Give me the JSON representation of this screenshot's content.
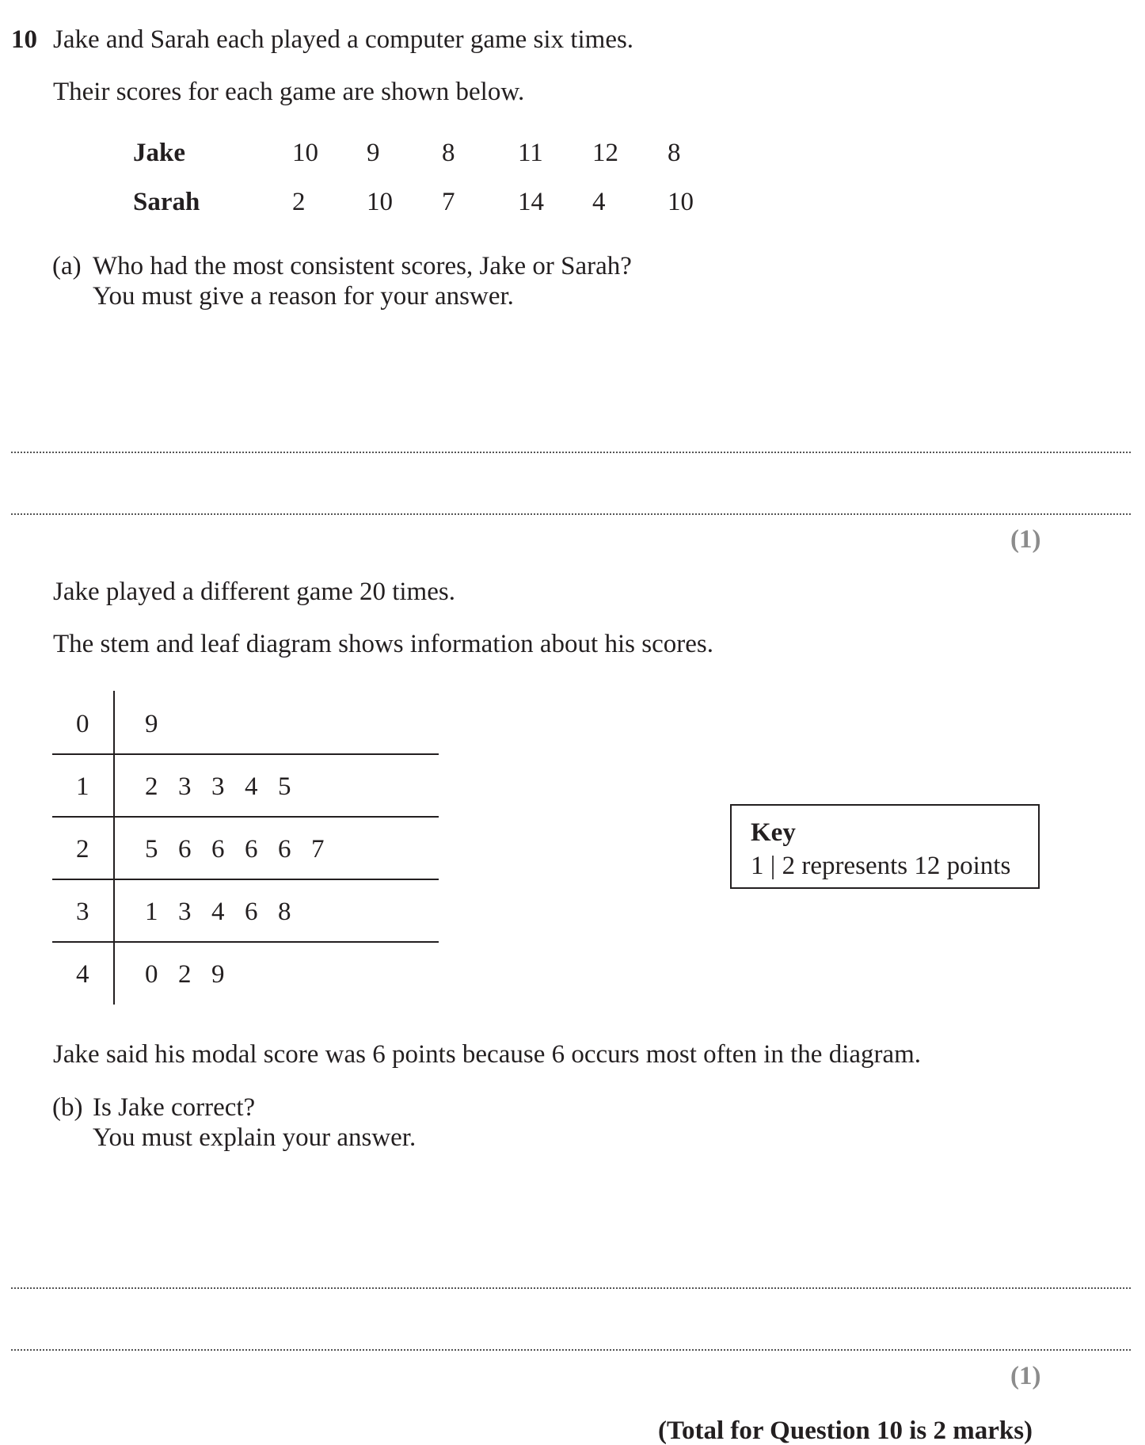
{
  "question": {
    "number": "10",
    "intro": "Jake and Sarah each played a computer game six times.",
    "scores_intro": "Their scores for each game are shown below."
  },
  "scores_table": {
    "rows": [
      {
        "name": "Jake",
        "values": [
          "10",
          "9",
          "8",
          "11",
          "12",
          "8"
        ]
      },
      {
        "name": "Sarah",
        "values": [
          "2",
          "10",
          "7",
          "14",
          "4",
          "10"
        ]
      }
    ]
  },
  "part_a": {
    "label": "(a)",
    "line1": "Who had the most consistent scores, Jake or Sarah?",
    "line2": "You must give a reason for your answer.",
    "marks": "(1)"
  },
  "stem_leaf_intro": {
    "line1": "Jake played a different game 20 times.",
    "line2": "The stem and leaf diagram shows information about his scores."
  },
  "stem_leaf": {
    "rows": [
      {
        "stem": "0",
        "leaves": [
          "9"
        ]
      },
      {
        "stem": "1",
        "leaves": [
          "2",
          "3",
          "3",
          "4",
          "5"
        ]
      },
      {
        "stem": "2",
        "leaves": [
          "5",
          "6",
          "6",
          "6",
          "6",
          "7"
        ]
      },
      {
        "stem": "3",
        "leaves": [
          "1",
          "3",
          "4",
          "6",
          "8"
        ]
      },
      {
        "stem": "4",
        "leaves": [
          "0",
          "2",
          "9"
        ]
      }
    ]
  },
  "key": {
    "title": "Key",
    "text": "1 | 2 represents 12 points"
  },
  "statement": "Jake said his modal score was 6 points because 6 occurs most often in the diagram.",
  "part_b": {
    "label": "(b)",
    "line1": "Is Jake correct?",
    "line2": "You must explain your answer.",
    "marks": "(1)"
  },
  "total": "(Total for Question 10 is 2 marks)"
}
